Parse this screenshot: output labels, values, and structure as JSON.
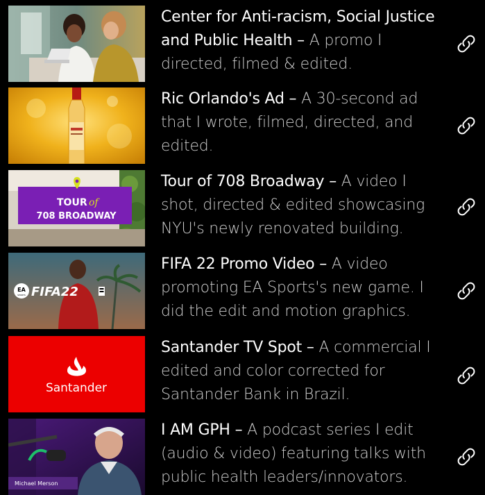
{
  "colors": {
    "background": "#000000",
    "title": "#ffffff",
    "body": "#cfcfcf",
    "santander_red": "#ec0000",
    "purple_banner": "#7a1fb4",
    "marker_yellow": "#d6e21d"
  },
  "projects": [
    {
      "title": "Center for Anti-racism, Social Justice and Public Health",
      "separator": "–",
      "description": "A promo I directed, filmed & edited.",
      "thumbnail": "two-women-laptop-thumbnail",
      "link_icon": "link-icon"
    },
    {
      "title": "Ric Orlando's Ad",
      "separator": "–",
      "description": "A 30-second ad that I wrote, filmed, directed, and edited.",
      "thumbnail": "hot-sauce-bottle-thumbnail",
      "link_icon": "link-icon"
    },
    {
      "title": "Tour of 708 Broadway",
      "separator": "–",
      "description": "A video I shot, directed & edited showcasing NYU's newly renovated building.",
      "thumbnail": "tour-708-broadway-thumbnail",
      "thumb_text": {
        "line1a": "TOUR",
        "line1b": "of",
        "line2": "708 BROADWAY"
      },
      "link_icon": "link-icon"
    },
    {
      "title": "FIFA 22 Promo Video",
      "separator": "–",
      "description": "A video promoting EA Sports's new game. I did the edit and motion graphics.",
      "thumbnail": "fifa22-thumbnail",
      "thumb_text": {
        "logo": "FIFA22",
        "ea": "EA",
        "sports": "SPORTS"
      },
      "link_icon": "link-icon"
    },
    {
      "title": "Santander TV Spot",
      "separator": "–",
      "description": "A commercial I edited and color corrected for Santander Bank in Brazil.",
      "thumbnail": "santander-thumbnail",
      "thumb_text": {
        "brand": "Santander"
      },
      "link_icon": "link-icon"
    },
    {
      "title": "I AM GPH",
      "separator": "–",
      "description": "A podcast series I edit (audio & video) featuring talks with public health leaders/innovators.",
      "thumbnail": "podcast-guest-thumbnail",
      "thumb_text": {
        "caption": "Michael Merson"
      },
      "link_icon": "link-icon"
    }
  ]
}
